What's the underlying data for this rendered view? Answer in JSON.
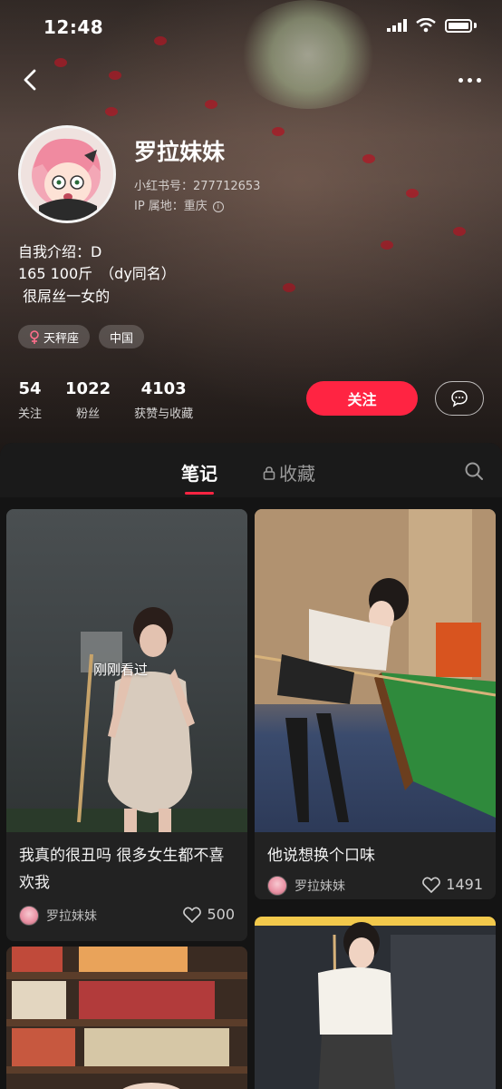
{
  "status": {
    "time": "12:48"
  },
  "profile": {
    "name": "罗拉妹妹",
    "red_id": "小红书号：277712653",
    "ip_location": "IP 属地：重庆",
    "bio": [
      "自我介绍：D",
      "165 100斤　（dy同名）",
      " 很屌丝一女的"
    ],
    "tags": [
      {
        "icon": "female-icon",
        "label": "天秤座"
      },
      {
        "label": "中国"
      }
    ]
  },
  "stats": [
    {
      "value": "54",
      "label": "关注"
    },
    {
      "value": "1022",
      "label": "粉丝"
    },
    {
      "value": "4103",
      "label": "获赞与收藏"
    }
  ],
  "actions": {
    "follow_label": "关注"
  },
  "tabs": {
    "notes": "笔记",
    "collect": "收藏"
  },
  "notes": [
    {
      "title": "我真的很丑吗 很多女生都不喜欢我",
      "author": "罗拉妹妹",
      "likes": "500",
      "badge": "刚刚看过"
    },
    {
      "title": "他说想换个口味",
      "author": "罗拉妹妹",
      "likes": "1491"
    }
  ],
  "colors": {
    "accent": "#ff2442",
    "sheet_bg": "#141414",
    "card_bg": "#222222"
  }
}
